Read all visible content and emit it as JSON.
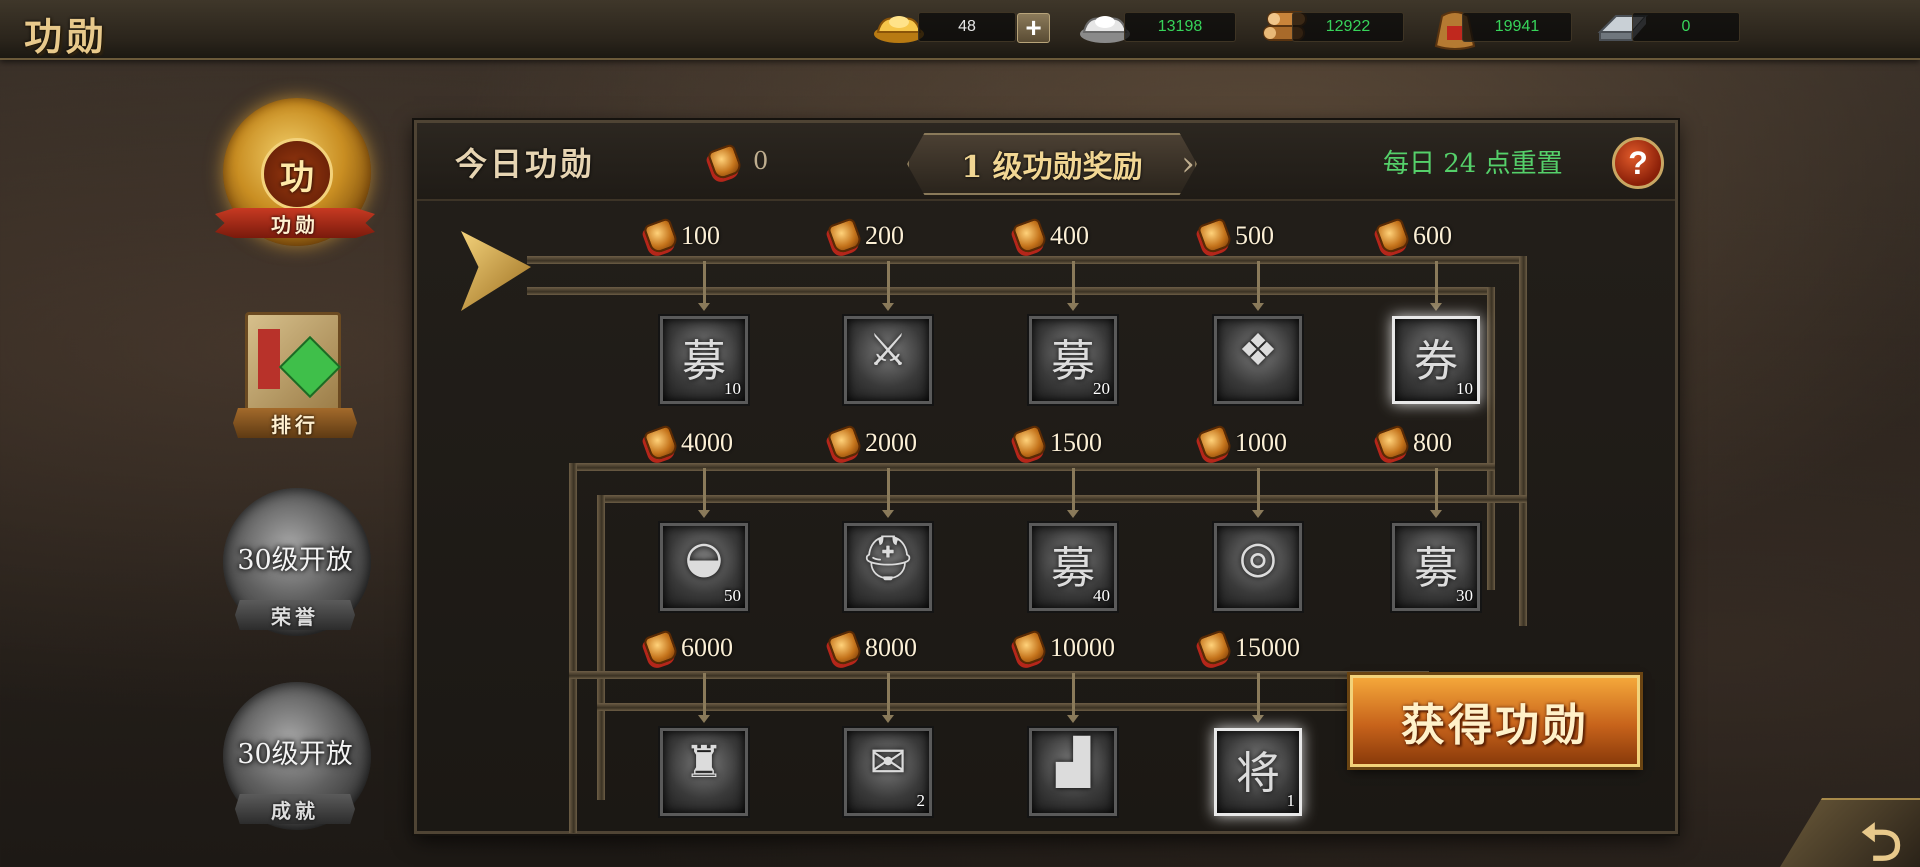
{
  "header": {
    "title": "功勋",
    "resources": [
      {
        "icon": "gold-ingot-icon",
        "value": "48"
      },
      {
        "icon": "silver-ingot-icon",
        "value": "13198"
      },
      {
        "icon": "wood-logs-icon",
        "value": "12922"
      },
      {
        "icon": "grain-sack-icon",
        "value": "19941"
      },
      {
        "icon": "iron-bar-icon",
        "value": "0"
      }
    ],
    "plus_label": "+"
  },
  "sidebar": {
    "items": [
      {
        "label": "功勋",
        "badge": "功",
        "state": "active"
      },
      {
        "label": "排行",
        "state": "enabled"
      },
      {
        "label": "荣誉",
        "lock_text": "30级开放",
        "state": "locked"
      },
      {
        "label": "成就",
        "lock_text": "30级开放",
        "state": "locked"
      }
    ]
  },
  "panel": {
    "today_label": "今日功勋",
    "today_value": "0",
    "tier_title": "1 级功勋奖励",
    "reset_text": "每日 24 点重置",
    "help_label": "?",
    "rows": [
      [
        {
          "threshold": "100",
          "item": "recruit-token-icon",
          "glyph": "募",
          "qty": "10",
          "highlight": false
        },
        {
          "threshold": "200",
          "item": "spear-icon",
          "glyph": "⚔",
          "qty": "",
          "highlight": false
        },
        {
          "threshold": "400",
          "item": "recruit-token-icon",
          "glyph": "募",
          "qty": "20",
          "highlight": false
        },
        {
          "threshold": "500",
          "item": "war-banner-icon",
          "glyph": "❖",
          "qty": "",
          "highlight": false
        },
        {
          "threshold": "600",
          "item": "voucher-icon",
          "glyph": "券",
          "qty": "10",
          "highlight": true
        }
      ],
      [
        {
          "threshold": "4000",
          "item": "silver-ingot-icon",
          "glyph": "◒",
          "qty": "50",
          "highlight": false
        },
        {
          "threshold": "2000",
          "item": "helmet-icon",
          "glyph": "⛑",
          "qty": "",
          "highlight": false
        },
        {
          "threshold": "1500",
          "item": "recruit-token-icon",
          "glyph": "募",
          "qty": "40",
          "highlight": false
        },
        {
          "threshold": "1000",
          "item": "ring-icon",
          "glyph": "◎",
          "qty": "",
          "highlight": false
        },
        {
          "threshold": "800",
          "item": "recruit-token-icon",
          "glyph": "募",
          "qty": "30",
          "highlight": false
        }
      ],
      [
        {
          "threshold": "6000",
          "item": "armor-icon",
          "glyph": "♜",
          "qty": "",
          "highlight": false
        },
        {
          "threshold": "8000",
          "item": "skill-scroll-icon",
          "glyph": "✉",
          "qty": "2",
          "highlight": false
        },
        {
          "threshold": "10000",
          "item": "boots-icon",
          "glyph": "▟",
          "qty": "",
          "highlight": false
        },
        {
          "threshold": "15000",
          "item": "general-token-icon",
          "glyph": "将",
          "qty": "1",
          "highlight": true
        }
      ]
    ],
    "earn_button": "获得功勋"
  },
  "back_button": "back-arrow-icon",
  "colors": {
    "accent_gold": "#e8c98b",
    "reset_green": "#55d06a",
    "resource_green": "#37d45a",
    "earn_orange": "#c7631b"
  }
}
